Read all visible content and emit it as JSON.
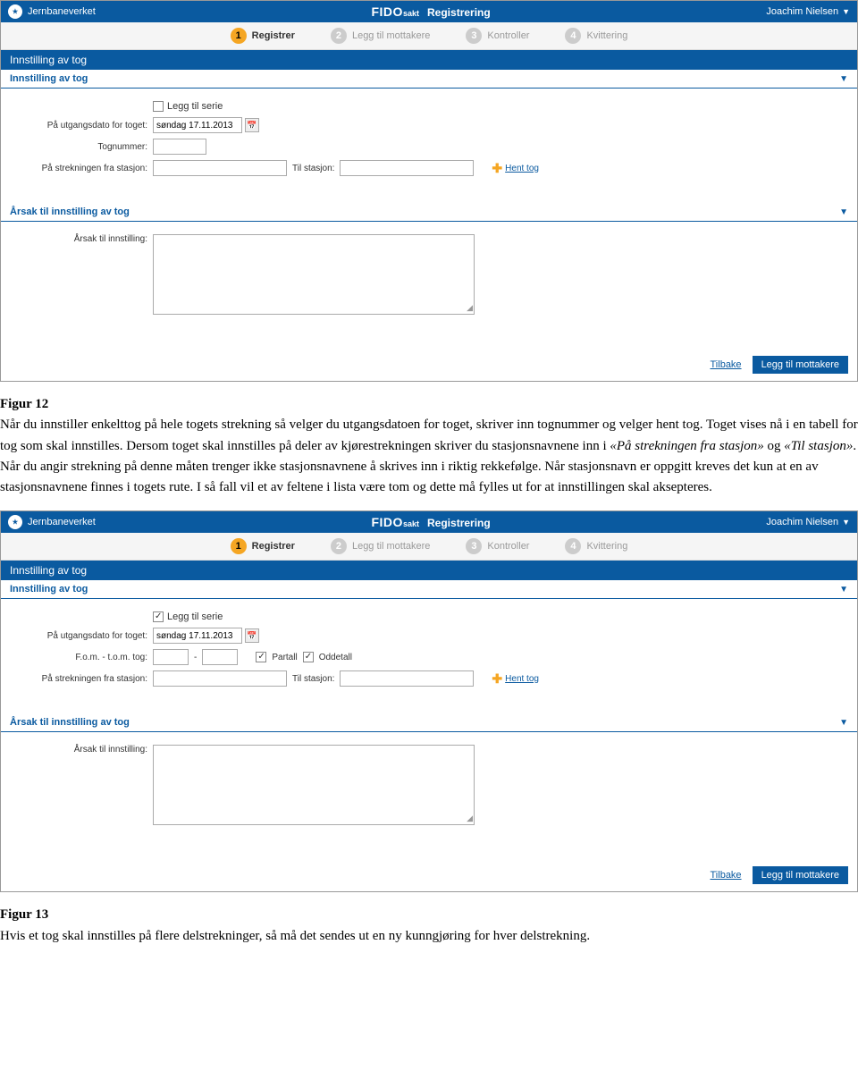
{
  "topbar": {
    "brand_left": "Jernbaneverket",
    "app_name": "FIDO",
    "app_sub": "sakt",
    "section": "Registrering",
    "user": "Joachim Nielsen"
  },
  "steps": [
    {
      "num": "1",
      "label": "Registrer",
      "active": true
    },
    {
      "num": "2",
      "label": "Legg til mottakere",
      "active": false
    },
    {
      "num": "3",
      "label": "Kontroller",
      "active": false
    },
    {
      "num": "4",
      "label": "Kvittering",
      "active": false
    }
  ],
  "section_title": "Innstilling av tog",
  "subsection_title": "Innstilling av tog",
  "form1": {
    "legg_til_serie": "Legg til serie",
    "utgangsdato_label": "På utgangsdato for toget:",
    "utgangsdato_value": "søndag 17.11.2013",
    "tognummer_label": "Tognummer:",
    "fra_stasjon_label": "På strekningen fra stasjon:",
    "til_stasjon_label": "Til stasjon:",
    "hent_tog": "Hent tog"
  },
  "arsak_section": "Årsak til innstilling av tog",
  "arsak_label": "Årsak til innstilling:",
  "footer": {
    "tilbake": "Tilbake",
    "legg_til": "Legg til mottakere"
  },
  "caption1_title": "Figur 12",
  "caption1_body": "Når du innstiller enkelttog på hele togets strekning så velger du utgangsdatoen for toget, skriver inn tognummer og velger hent tog.  Toget vises nå i en tabell for tog som skal innstilles. Dersom toget skal innstilles på deler av kjørestrekningen skriver du stasjonsnavnene inn i «På strekningen fra stasjon» og «Til stasjon».  Når du angir strekning på denne måten trenger ikke stasjonsnavnene å skrives inn i riktig rekkefølge. Når stasjonsnavn er oppgitt kreves det kun at en av stasjonsnavnene finnes i togets rute.  I så fall vil et av feltene i lista være tom og dette må fylles ut for at innstillingen skal aksepteres.",
  "form2": {
    "legg_til_serie": "Legg til serie",
    "utgangsdato_label": "På utgangsdato for toget:",
    "utgangsdato_value": "søndag 17.11.2013",
    "fom_tom_label": "F.o.m. - t.o.m. tog:",
    "partall": "Partall",
    "oddetall": "Oddetall",
    "fra_stasjon_label": "På strekningen fra stasjon:",
    "til_stasjon_label": "Til stasjon:",
    "hent_tog": "Hent tog"
  },
  "caption2_title": "Figur 13",
  "caption2_body": "Hvis et tog skal innstilles på flere delstrekninger, så må det sendes ut en ny kunngjøring for hver delstrekning."
}
